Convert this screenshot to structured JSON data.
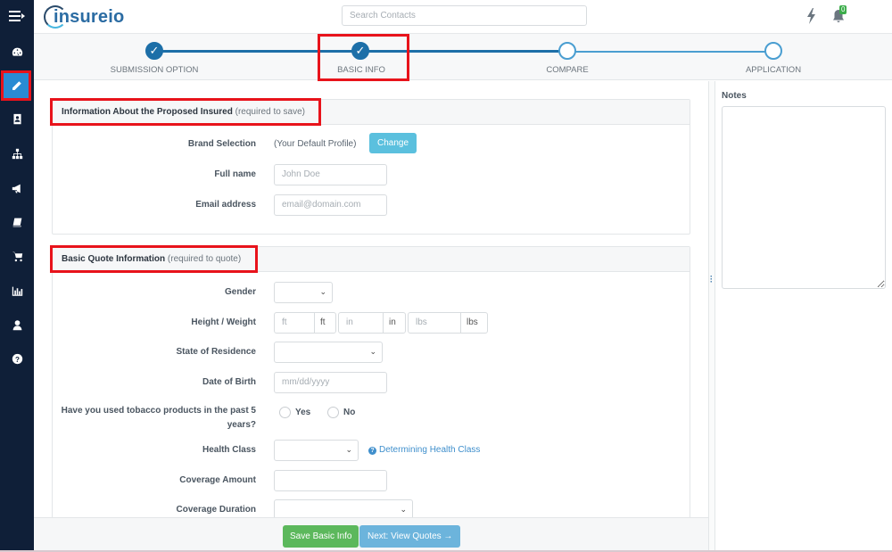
{
  "app": {
    "logo_text": "insureio"
  },
  "header": {
    "search_placeholder": "Search Contacts",
    "notification_count": "0"
  },
  "sidebar": {
    "items": [
      {
        "icon": "dashboard-icon"
      },
      {
        "icon": "pencil-icon",
        "active": true
      },
      {
        "icon": "contact-card-icon"
      },
      {
        "icon": "org-chart-icon"
      },
      {
        "icon": "megaphone-icon"
      },
      {
        "icon": "book-icon"
      },
      {
        "icon": "cart-icon"
      },
      {
        "icon": "bar-chart-icon"
      },
      {
        "icon": "user-icon"
      },
      {
        "icon": "help-icon"
      }
    ]
  },
  "stepper": {
    "steps": [
      {
        "label": "SUBMISSION OPTION",
        "status": "done"
      },
      {
        "label": "BASIC INFO",
        "status": "done"
      },
      {
        "label": "COMPARE",
        "status": "todo"
      },
      {
        "label": "APPLICATION",
        "status": "todo"
      }
    ],
    "check": "✓"
  },
  "insured_section": {
    "title": "Information About the Proposed Insured",
    "note": "(required to save)",
    "brand_label": "Brand Selection",
    "brand_value": "(Your Default Profile)",
    "change_button": "Change",
    "full_name_label": "Full name",
    "full_name_placeholder": "John Doe",
    "email_label": "Email address",
    "email_placeholder": "email@domain.com"
  },
  "quote_section": {
    "title": "Basic Quote Information",
    "note": "(required to quote)",
    "gender_label": "Gender",
    "gender_value": "",
    "height_weight_label": "Height / Weight",
    "ft_placeholder": "ft",
    "ft_addon": "ft",
    "in_placeholder": "in",
    "in_addon": "in",
    "lbs_placeholder": "lbs",
    "lbs_addon": "lbs",
    "state_label": "State of Residence",
    "state_value": "",
    "dob_label": "Date of Birth",
    "dob_placeholder": "mm/dd/yyyy",
    "tobacco_label_line1": "Have you used tobacco products in the past 5",
    "tobacco_label_line2": "years?",
    "tobacco_yes": "Yes",
    "tobacco_no": "No",
    "health_class_label": "Health Class",
    "health_class_value": "",
    "health_class_link": "Determining Health Class",
    "coverage_amount_label": "Coverage Amount",
    "coverage_amount_value": "",
    "coverage_duration_label": "Coverage Duration",
    "coverage_duration_value": ""
  },
  "footer": {
    "save_button": "Save Basic Info",
    "next_button": "Next: View Quotes →"
  },
  "notes": {
    "label": "Notes",
    "value": ""
  }
}
